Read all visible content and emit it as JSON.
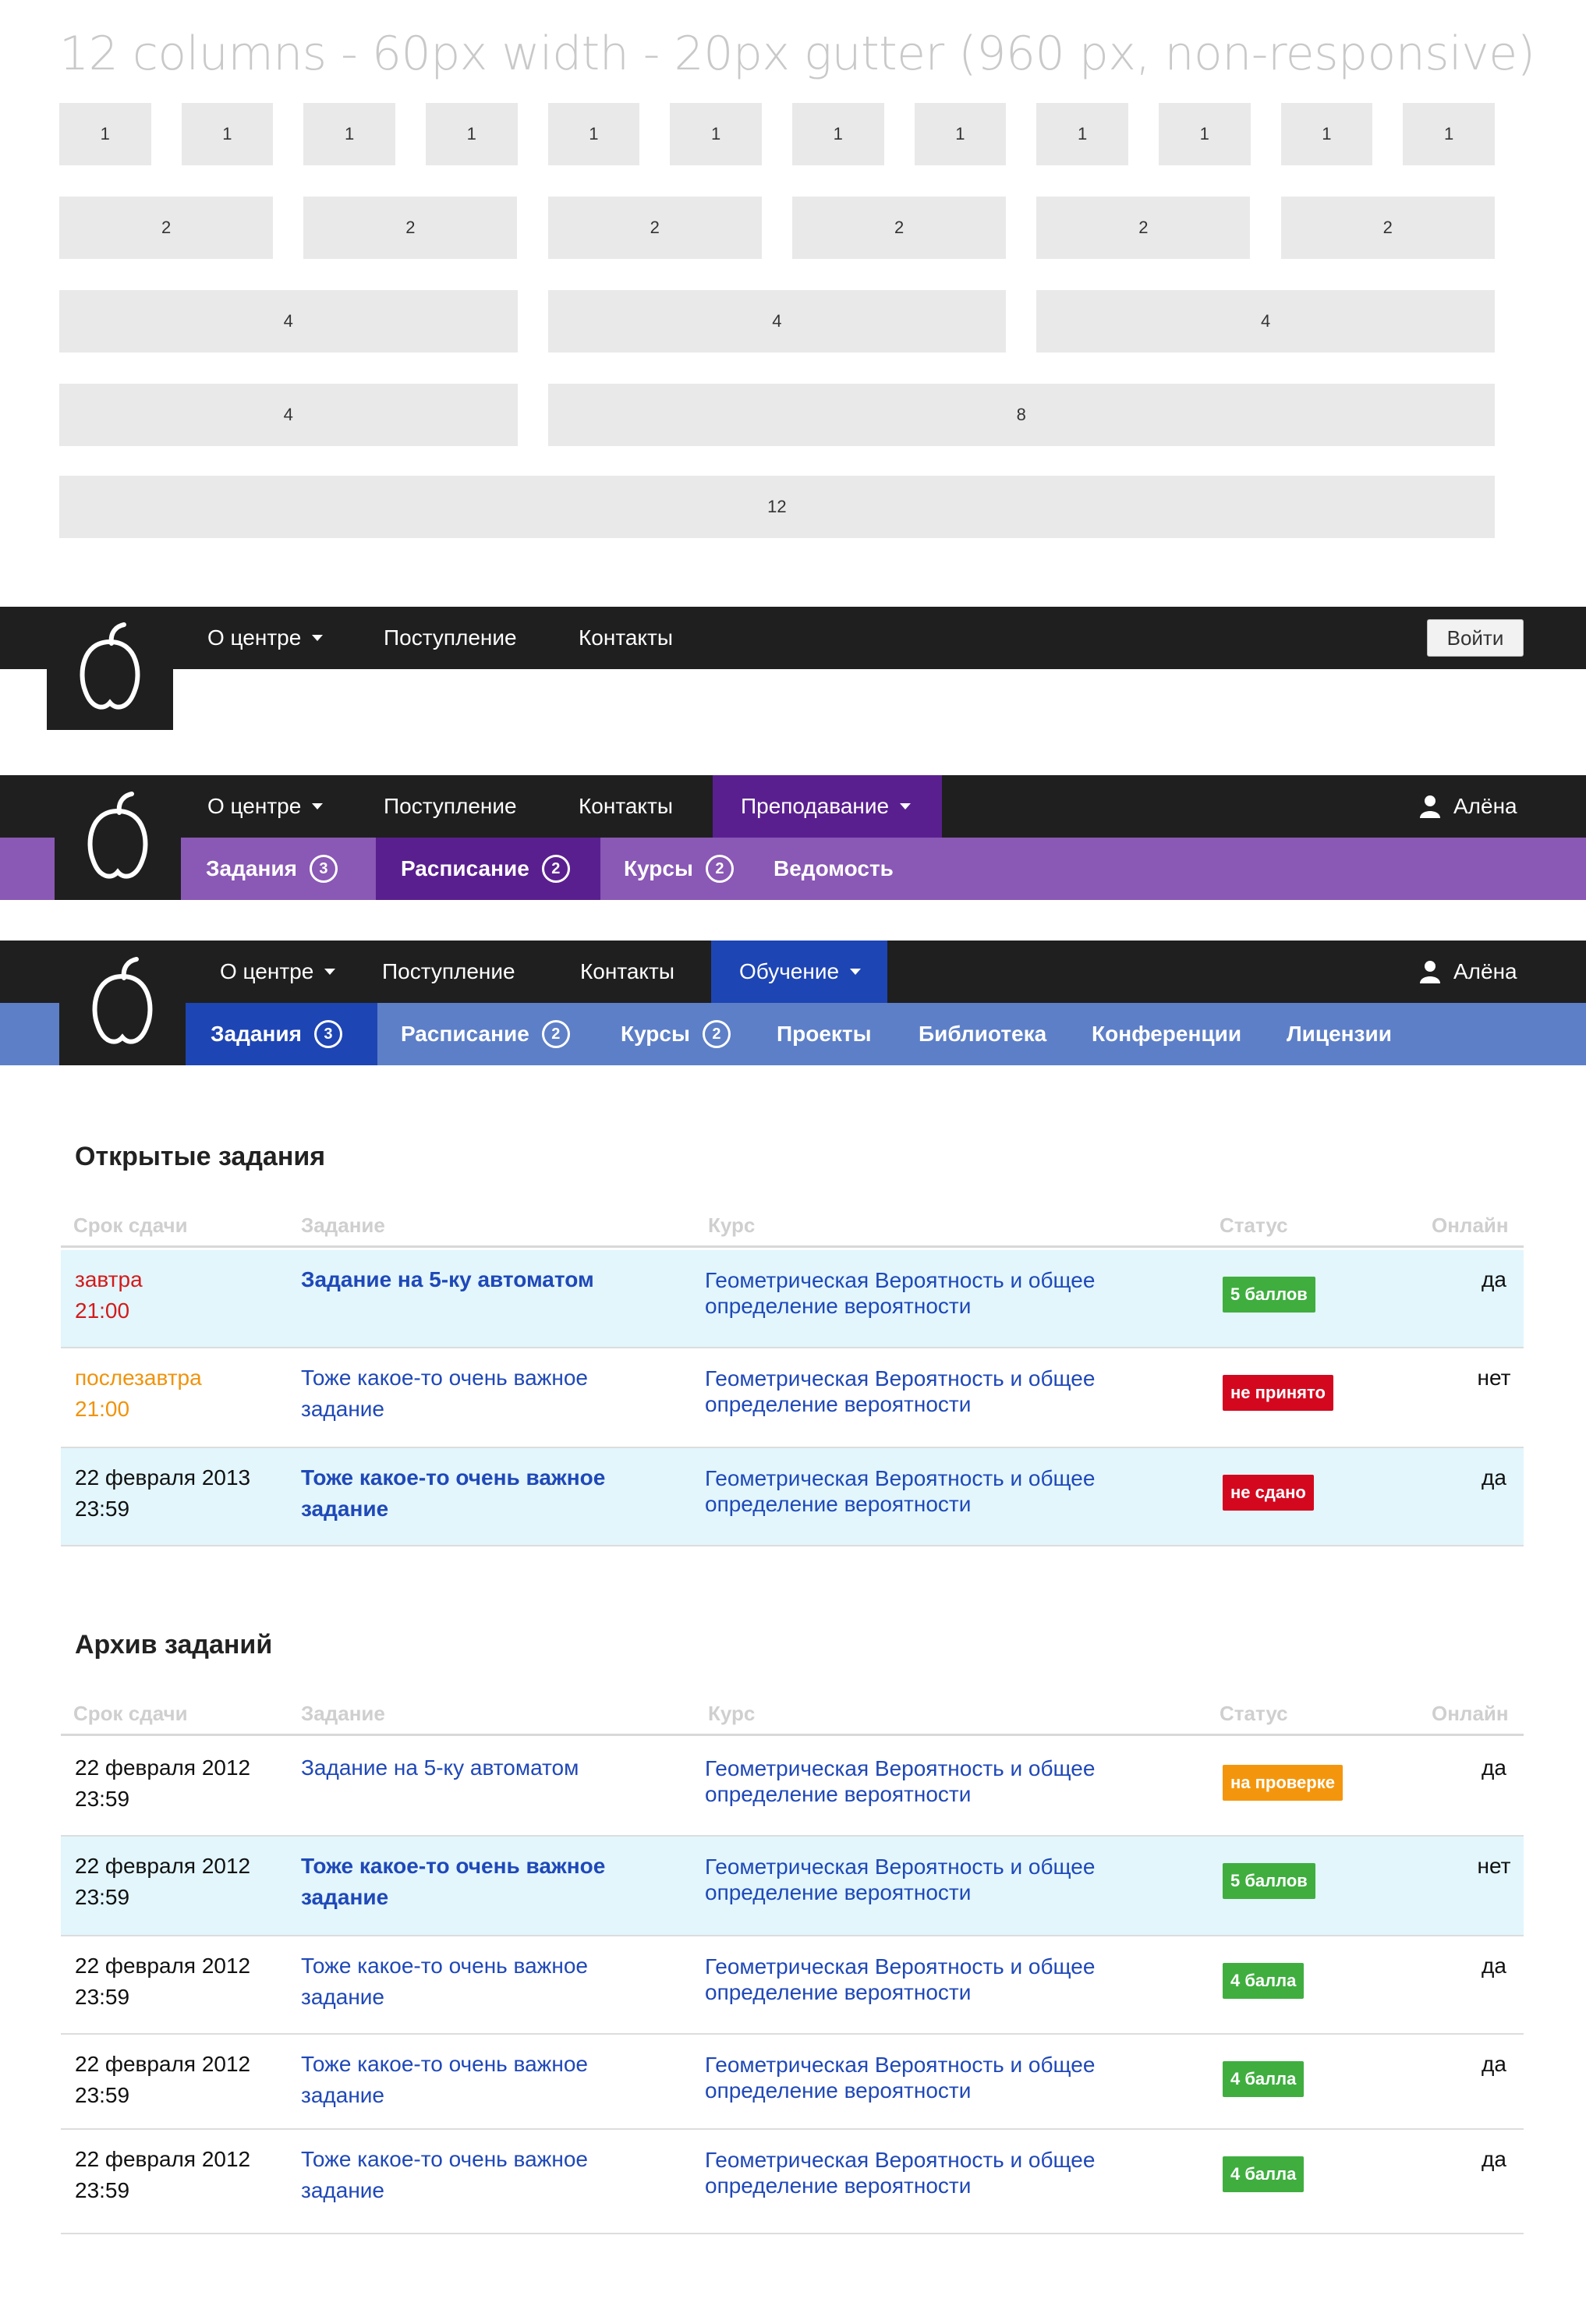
{
  "grid": {
    "title": "12 columns - 60px width - 20px gutter (960 px, non-responsive)",
    "rows": [
      [
        "1",
        "1",
        "1",
        "1",
        "1",
        "1",
        "1",
        "1",
        "1",
        "1",
        "1",
        "1"
      ],
      [
        "2",
        "2",
        "2",
        "2",
        "2",
        "2"
      ],
      [
        "4",
        "4",
        "4"
      ],
      [
        "4",
        "8"
      ],
      [
        "12"
      ]
    ]
  },
  "nav1": {
    "items": [
      "О центре",
      "Поступление",
      "Контакты"
    ],
    "login": "Войти"
  },
  "nav2": {
    "items": [
      "О центре",
      "Поступление",
      "Контакты",
      "Преподавание"
    ],
    "user": "Алёна",
    "sub": [
      {
        "label": "Задания",
        "count": "3"
      },
      {
        "label": "Расписание",
        "count": "2"
      },
      {
        "label": "Курсы",
        "count": "2"
      },
      {
        "label": "Ведомость",
        "count": ""
      }
    ],
    "colors": {
      "bar": "#8a58b5",
      "active": "#5a1f8f"
    }
  },
  "nav3": {
    "items": [
      "О центре",
      "Поступление",
      "Контакты",
      "Обучение"
    ],
    "user": "Алёна",
    "sub": [
      {
        "label": "Задания",
        "count": "3"
      },
      {
        "label": "Расписание",
        "count": "2"
      },
      {
        "label": "Курсы",
        "count": "2"
      },
      {
        "label": "Проекты",
        "count": ""
      },
      {
        "label": "Библиотека",
        "count": ""
      },
      {
        "label": "Конференции",
        "count": ""
      },
      {
        "label": "Лицензии",
        "count": ""
      }
    ],
    "colors": {
      "bar": "#5d7fc7",
      "active": "#1e45b4",
      "active_top": "#1e45b4"
    }
  },
  "open_tasks": {
    "title": "Открытые задания",
    "headers": [
      "Срок сдачи",
      "Задание",
      "Курс",
      "Статус",
      "Онлайн"
    ],
    "rows": [
      {
        "date1": "завтра",
        "date2": "21:00",
        "date_color": "red",
        "task": "Задание на 5-ку автоматом",
        "task_bold": true,
        "course1": "Геометрическая Вероятность и общее",
        "course2": "определение вероятности",
        "status": "5 баллов",
        "status_color": "green",
        "online": "да",
        "highlight": true
      },
      {
        "date1": "послезавтра",
        "date2": "21:00",
        "date_color": "orange",
        "task": "Тоже какое-то очень важное задание",
        "task_bold": false,
        "course1": "Геометрическая Вероятность и общее",
        "course2": "определение вероятности",
        "status": "не принято",
        "status_color": "red",
        "online": "нет",
        "highlight": false
      },
      {
        "date1": "22 февраля 2013",
        "date2": "23:59",
        "date_color": "black",
        "task": "Тоже какое-то очень важное задание",
        "task_bold": true,
        "course1": "Геометрическая Вероятность и общее",
        "course2": "определение вероятности",
        "status": "не сдано",
        "status_color": "red",
        "online": "да",
        "highlight": true
      }
    ]
  },
  "archive": {
    "title": "Архив заданий",
    "headers": [
      "Срок сдачи",
      "Задание",
      "Курс",
      "Статус",
      "Онлайн"
    ],
    "rows": [
      {
        "date1": "22 февраля 2012",
        "date2": "23:59",
        "date_color": "black",
        "task": "Задание на 5-ку автоматом",
        "task_bold": false,
        "course1": "Геометрическая Вероятность и общее",
        "course2": "определение вероятности",
        "status": "на проверке",
        "status_color": "orange",
        "online": "да",
        "highlight": false
      },
      {
        "date1": "22 февраля 2012",
        "date2": "23:59",
        "date_color": "black",
        "task": "Тоже какое-то очень важное задание",
        "task_bold": true,
        "course1": "Геометрическая Вероятность и общее",
        "course2": "определение вероятности",
        "status": "5 баллов",
        "status_color": "green",
        "online": "нет",
        "highlight": true
      },
      {
        "date1": "22 февраля 2012",
        "date2": "23:59",
        "date_color": "black",
        "task": "Тоже какое-то очень важное задание",
        "task_bold": false,
        "course1": "Геометрическая Вероятность и общее",
        "course2": "определение вероятности",
        "status": "4 балла",
        "status_color": "green",
        "online": "да",
        "highlight": false
      },
      {
        "date1": "22 февраля 2012",
        "date2": "23:59",
        "date_color": "black",
        "task": "Тоже какое-то очень важное задание",
        "task_bold": false,
        "course1": "Геометрическая Вероятность и общее",
        "course2": "определение вероятности",
        "status": "4 балла",
        "status_color": "green",
        "online": "да",
        "highlight": false
      },
      {
        "date1": "22 февраля 2012",
        "date2": "23:59",
        "date_color": "black",
        "task": "Тоже какое-то очень важное задание",
        "task_bold": false,
        "course1": "Геометрическая Вероятность и общее",
        "course2": "определение вероятности",
        "status": "4 балла",
        "status_color": "green",
        "online": "да",
        "highlight": false
      }
    ]
  }
}
